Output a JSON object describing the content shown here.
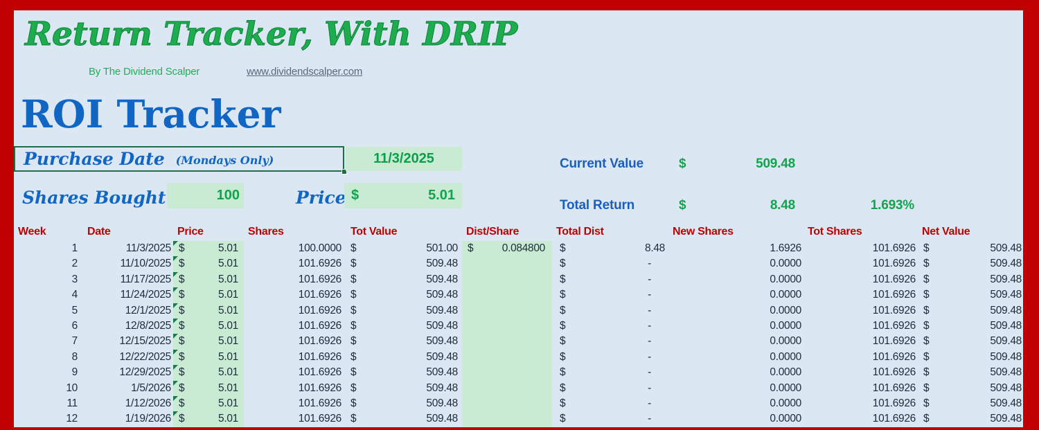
{
  "page": {
    "title": "Return Tracker, With DRIP",
    "byline": "By The Dividend Scalper",
    "website": "www.dividendscalper.com",
    "section_title": "ROI Tracker"
  },
  "inputs": {
    "purchase_date_label": "Purchase Date",
    "purchase_date_note": "(Mondays Only)",
    "purchase_date_value": "11/3/2025",
    "shares_bought_label": "Shares Bought",
    "shares_bought_value": "100",
    "price_label": "Price",
    "price_currency": "$",
    "price_value": "5.01"
  },
  "summary": {
    "current_value_label": "Current Value",
    "current_value_currency": "$",
    "current_value": "509.48",
    "total_return_label": "Total Return",
    "total_return_currency": "$",
    "total_return": "8.48",
    "total_return_pct": "1.693%"
  },
  "table": {
    "headers": {
      "week": "Week",
      "date": "Date",
      "price": "Price",
      "shares": "Shares",
      "tot_value": "Tot Value",
      "dist_share": "Dist/Share",
      "total_dist": "Total Dist",
      "new_shares": "New Shares",
      "tot_shares": "Tot Shares",
      "net_value": "Net Value"
    },
    "rows": [
      {
        "week": "1",
        "date": "11/3/2025",
        "price_cur": "$",
        "price": "5.01",
        "shares": "100.0000",
        "tot_value_cur": "$",
        "tot_value": "501.00",
        "dist_share_cur": "$",
        "dist_share": "0.084800",
        "total_dist_cur": "$",
        "total_dist": "8.48",
        "new_shares": "1.6926",
        "tot_shares": "101.6926",
        "net_value_cur": "$",
        "net_value": "509.48"
      },
      {
        "week": "2",
        "date": "11/10/2025",
        "price_cur": "$",
        "price": "5.01",
        "shares": "101.6926",
        "tot_value_cur": "$",
        "tot_value": "509.48",
        "dist_share_cur": "",
        "dist_share": "",
        "total_dist_cur": "$",
        "total_dist": "-",
        "new_shares": "0.0000",
        "tot_shares": "101.6926",
        "net_value_cur": "$",
        "net_value": "509.48"
      },
      {
        "week": "3",
        "date": "11/17/2025",
        "price_cur": "$",
        "price": "5.01",
        "shares": "101.6926",
        "tot_value_cur": "$",
        "tot_value": "509.48",
        "dist_share_cur": "",
        "dist_share": "",
        "total_dist_cur": "$",
        "total_dist": "-",
        "new_shares": "0.0000",
        "tot_shares": "101.6926",
        "net_value_cur": "$",
        "net_value": "509.48"
      },
      {
        "week": "4",
        "date": "11/24/2025",
        "price_cur": "$",
        "price": "5.01",
        "shares": "101.6926",
        "tot_value_cur": "$",
        "tot_value": "509.48",
        "dist_share_cur": "",
        "dist_share": "",
        "total_dist_cur": "$",
        "total_dist": "-",
        "new_shares": "0.0000",
        "tot_shares": "101.6926",
        "net_value_cur": "$",
        "net_value": "509.48"
      },
      {
        "week": "5",
        "date": "12/1/2025",
        "price_cur": "$",
        "price": "5.01",
        "shares": "101.6926",
        "tot_value_cur": "$",
        "tot_value": "509.48",
        "dist_share_cur": "",
        "dist_share": "",
        "total_dist_cur": "$",
        "total_dist": "-",
        "new_shares": "0.0000",
        "tot_shares": "101.6926",
        "net_value_cur": "$",
        "net_value": "509.48"
      },
      {
        "week": "6",
        "date": "12/8/2025",
        "price_cur": "$",
        "price": "5.01",
        "shares": "101.6926",
        "tot_value_cur": "$",
        "tot_value": "509.48",
        "dist_share_cur": "",
        "dist_share": "",
        "total_dist_cur": "$",
        "total_dist": "-",
        "new_shares": "0.0000",
        "tot_shares": "101.6926",
        "net_value_cur": "$",
        "net_value": "509.48"
      },
      {
        "week": "7",
        "date": "12/15/2025",
        "price_cur": "$",
        "price": "5.01",
        "shares": "101.6926",
        "tot_value_cur": "$",
        "tot_value": "509.48",
        "dist_share_cur": "",
        "dist_share": "",
        "total_dist_cur": "$",
        "total_dist": "-",
        "new_shares": "0.0000",
        "tot_shares": "101.6926",
        "net_value_cur": "$",
        "net_value": "509.48"
      },
      {
        "week": "8",
        "date": "12/22/2025",
        "price_cur": "$",
        "price": "5.01",
        "shares": "101.6926",
        "tot_value_cur": "$",
        "tot_value": "509.48",
        "dist_share_cur": "",
        "dist_share": "",
        "total_dist_cur": "$",
        "total_dist": "-",
        "new_shares": "0.0000",
        "tot_shares": "101.6926",
        "net_value_cur": "$",
        "net_value": "509.48"
      },
      {
        "week": "9",
        "date": "12/29/2025",
        "price_cur": "$",
        "price": "5.01",
        "shares": "101.6926",
        "tot_value_cur": "$",
        "tot_value": "509.48",
        "dist_share_cur": "",
        "dist_share": "",
        "total_dist_cur": "$",
        "total_dist": "-",
        "new_shares": "0.0000",
        "tot_shares": "101.6926",
        "net_value_cur": "$",
        "net_value": "509.48"
      },
      {
        "week": "10",
        "date": "1/5/2026",
        "price_cur": "$",
        "price": "5.01",
        "shares": "101.6926",
        "tot_value_cur": "$",
        "tot_value": "509.48",
        "dist_share_cur": "",
        "dist_share": "",
        "total_dist_cur": "$",
        "total_dist": "-",
        "new_shares": "0.0000",
        "tot_shares": "101.6926",
        "net_value_cur": "$",
        "net_value": "509.48"
      },
      {
        "week": "11",
        "date": "1/12/2026",
        "price_cur": "$",
        "price": "5.01",
        "shares": "101.6926",
        "tot_value_cur": "$",
        "tot_value": "509.48",
        "dist_share_cur": "",
        "dist_share": "",
        "total_dist_cur": "$",
        "total_dist": "-",
        "new_shares": "0.0000",
        "tot_shares": "101.6926",
        "net_value_cur": "$",
        "net_value": "509.48"
      },
      {
        "week": "12",
        "date": "1/19/2026",
        "price_cur": "$",
        "price": "5.01",
        "shares": "101.6926",
        "tot_value_cur": "$",
        "tot_value": "509.48",
        "dist_share_cur": "",
        "dist_share": "",
        "total_dist_cur": "$",
        "total_dist": "-",
        "new_shares": "0.0000",
        "tot_shares": "101.6926",
        "net_value_cur": "$",
        "net_value": "509.48"
      }
    ]
  },
  "colors": {
    "page_border_red": "#c00000",
    "sheet_background": "#dbe8f4",
    "input_fill_green": "#c9ebd3",
    "value_text_green": "#12a34c",
    "label_text_blue": "#1165c3",
    "header_text_red": "#c00000",
    "selection_border_green": "#1c6e43"
  }
}
